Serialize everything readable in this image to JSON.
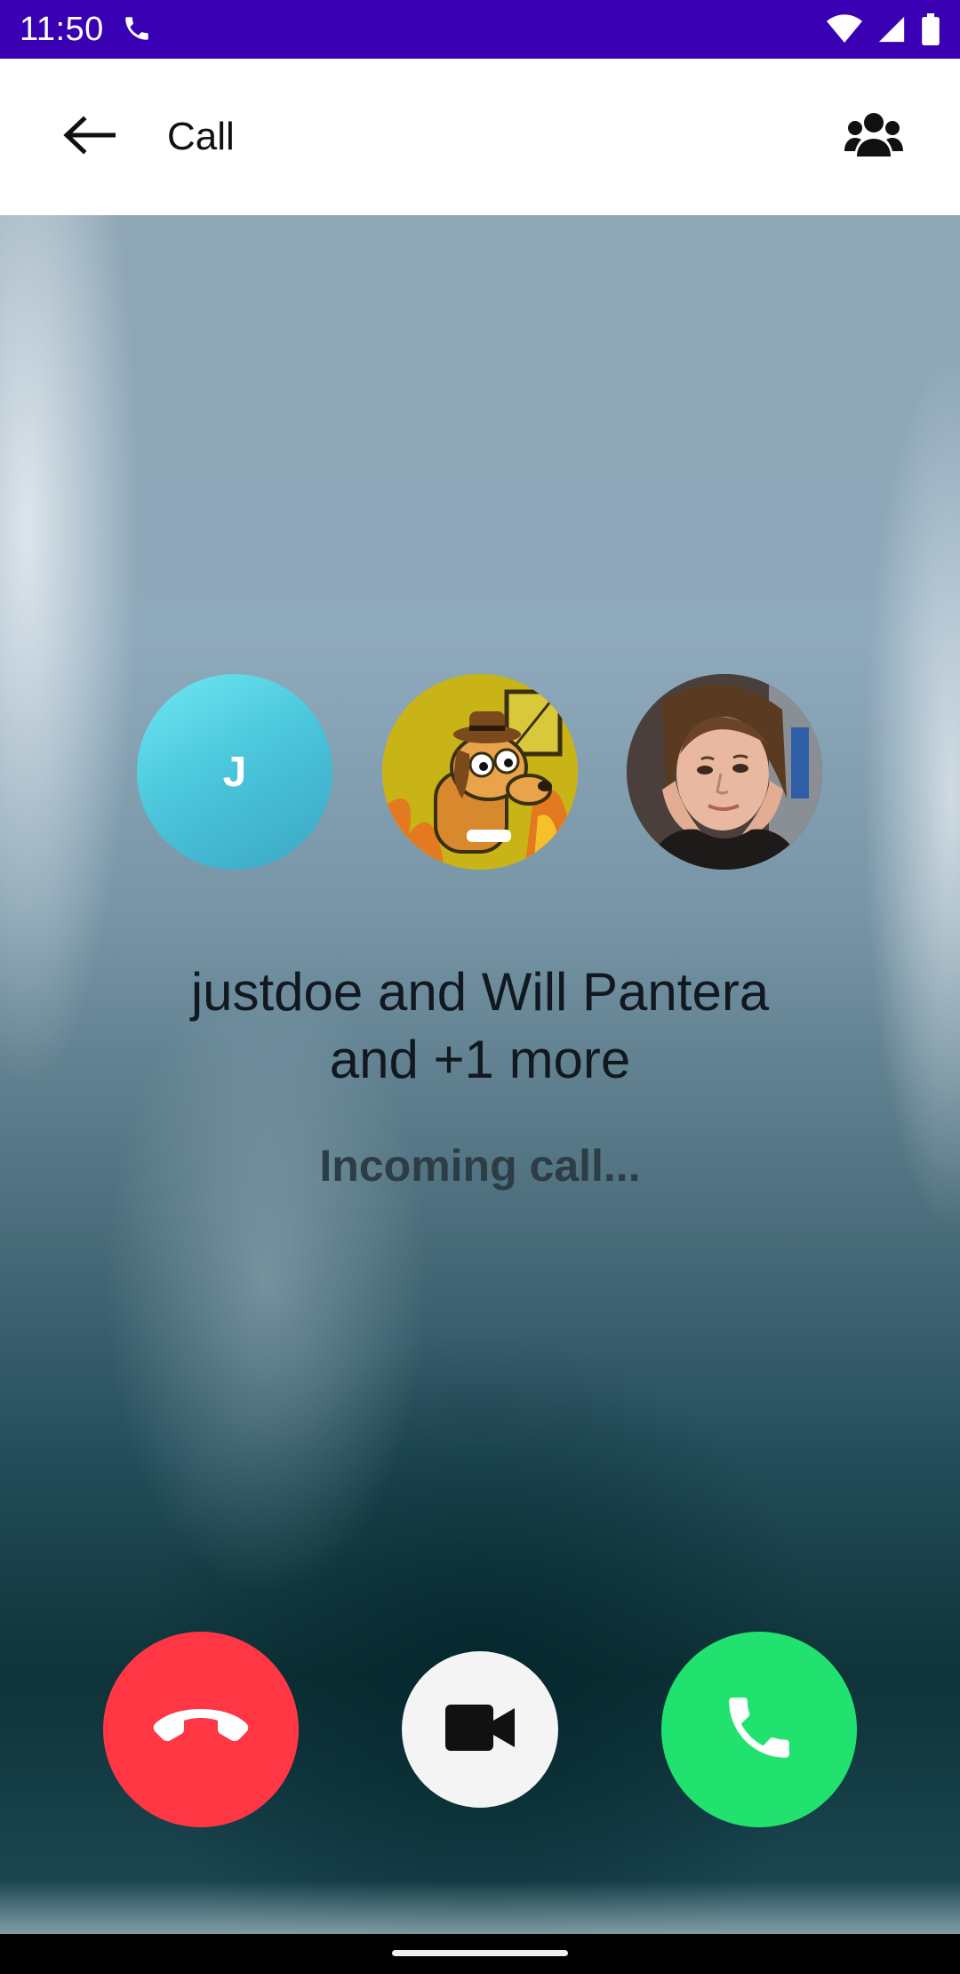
{
  "status_bar": {
    "time": "11:50",
    "icons": [
      "phone-call-icon",
      "wifi-icon",
      "signal-icon",
      "battery-icon"
    ]
  },
  "app_bar": {
    "title": "Call",
    "back_icon": "arrow-left-icon",
    "participants_icon": "group-icon"
  },
  "call": {
    "participants": [
      {
        "initial": "J",
        "kind": "initial-avatar"
      },
      {
        "kind": "image-avatar",
        "depicts": "dog"
      },
      {
        "kind": "image-avatar",
        "depicts": "person"
      }
    ],
    "title_line1": "justdoe and Will Pantera",
    "title_line2": "and +1 more",
    "status": "Incoming call..."
  },
  "actions": {
    "decline_icon": "call-end-icon",
    "video_icon": "videocam-icon",
    "accept_icon": "call-icon"
  },
  "colors": {
    "status_bar": "#3a00b3",
    "decline": "#ff3745",
    "accept": "#21e26e",
    "video": "#f4f4f4"
  }
}
